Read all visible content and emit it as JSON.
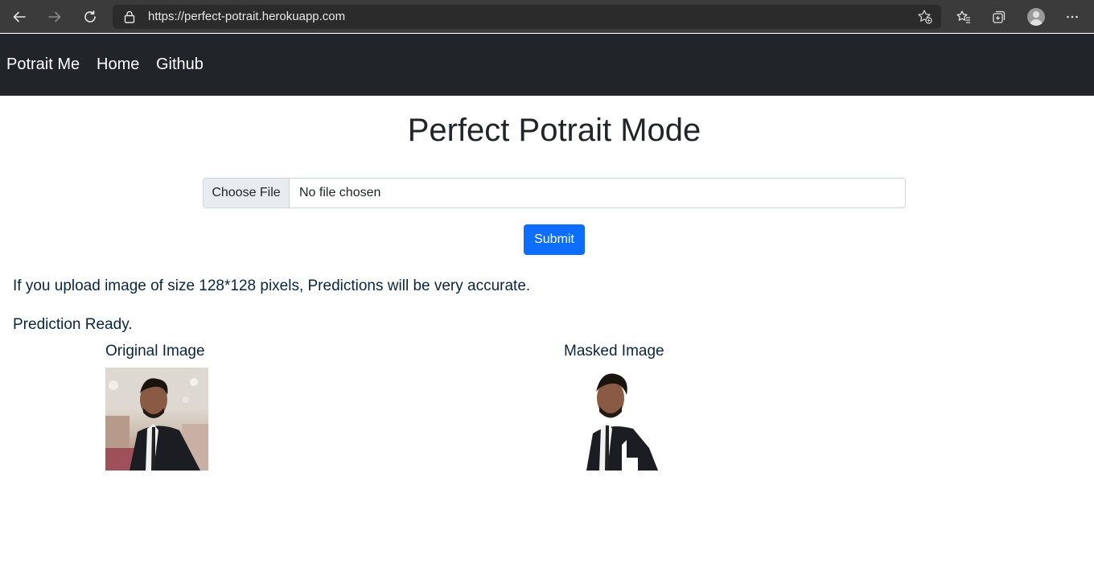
{
  "browser": {
    "url": "https://perfect-potrait.herokuapp.com"
  },
  "navbar": {
    "brand": "Potrait Me",
    "links": [
      "Home",
      "Github"
    ]
  },
  "main": {
    "title": "Perfect Potrait Mode",
    "file_input": {
      "button_label": "Choose File",
      "status": "No file chosen"
    },
    "submit_label": "Submit",
    "note": "If you upload image of size 128*128 pixels, Predictions will be very accurate.",
    "status": "Prediction Ready.",
    "original_caption": "Original Image",
    "masked_caption": "Masked Image"
  },
  "colors": {
    "navbar_bg": "#212529",
    "primary_button": "#0d6efd",
    "text_dark_blue": "#0a2540"
  },
  "icons": [
    "back-arrow-icon",
    "forward-arrow-icon",
    "refresh-icon",
    "lock-icon",
    "add-favorite-icon",
    "favorites-icon",
    "collections-icon",
    "profile-avatar",
    "more-options-icon"
  ]
}
